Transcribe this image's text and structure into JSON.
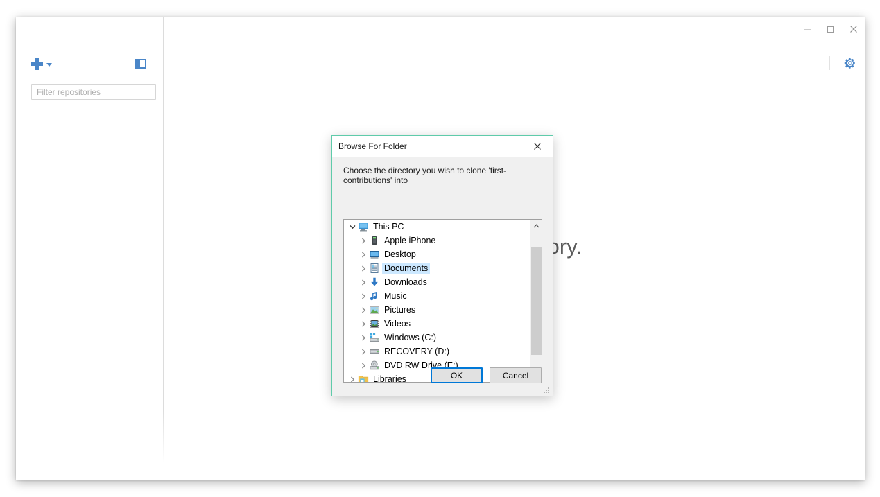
{
  "window": {
    "controls": [
      {
        "name": "minimize",
        "glyph": "minimize-icon"
      },
      {
        "name": "maximize",
        "glyph": "maximize-icon"
      },
      {
        "name": "close",
        "glyph": "close-icon"
      }
    ],
    "settings_icon": "gear-icon"
  },
  "sidebar": {
    "add_button_label": "add-repository",
    "add_caret_label": "chevron-down",
    "panel_toggle_label": "toggle-sidebar",
    "filter": {
      "value": "",
      "placeholder": "Filter repositories"
    }
  },
  "main": {
    "empty_state_text": "g a repository."
  },
  "dialog": {
    "title": "Browse For Folder",
    "close_label": "×",
    "prompt": "Choose the directory you wish to clone 'first-contributions' into",
    "tree": [
      {
        "label": "This PC",
        "icon": "monitor-icon",
        "depth": 0,
        "expander": "expanded",
        "selected": false
      },
      {
        "label": "Apple iPhone",
        "icon": "phone-icon",
        "depth": 1,
        "expander": "collapsed",
        "selected": false
      },
      {
        "label": "Desktop",
        "icon": "desktop-icon",
        "depth": 1,
        "expander": "collapsed",
        "selected": false
      },
      {
        "label": "Documents",
        "icon": "document-icon",
        "depth": 1,
        "expander": "collapsed",
        "selected": true
      },
      {
        "label": "Downloads",
        "icon": "download-icon",
        "depth": 1,
        "expander": "collapsed",
        "selected": false
      },
      {
        "label": "Music",
        "icon": "music-icon",
        "depth": 1,
        "expander": "collapsed",
        "selected": false
      },
      {
        "label": "Pictures",
        "icon": "pictures-icon",
        "depth": 1,
        "expander": "collapsed",
        "selected": false
      },
      {
        "label": "Videos",
        "icon": "videos-icon",
        "depth": 1,
        "expander": "collapsed",
        "selected": false
      },
      {
        "label": "Windows (C:)",
        "icon": "sysdrive-icon",
        "depth": 1,
        "expander": "collapsed",
        "selected": false
      },
      {
        "label": "RECOVERY (D:)",
        "icon": "drive-icon",
        "depth": 1,
        "expander": "collapsed",
        "selected": false
      },
      {
        "label": "DVD RW Drive (E:)",
        "icon": "disc-icon",
        "depth": 1,
        "expander": "collapsed",
        "selected": false
      },
      {
        "label": "Libraries",
        "icon": "folder-icon",
        "depth": 0,
        "expander": "collapsed",
        "selected": false
      }
    ],
    "buttons": {
      "ok": "OK",
      "cancel": "Cancel"
    },
    "scrollbar": {
      "up_arrow": "chevron-up-icon",
      "down_arrow": "chevron-down-icon"
    }
  },
  "colors": {
    "accent_blue": "#4a86c8",
    "dialog_border": "#5fcbaa",
    "selection": "#cce8ff",
    "focus_border": "#0078d7"
  }
}
